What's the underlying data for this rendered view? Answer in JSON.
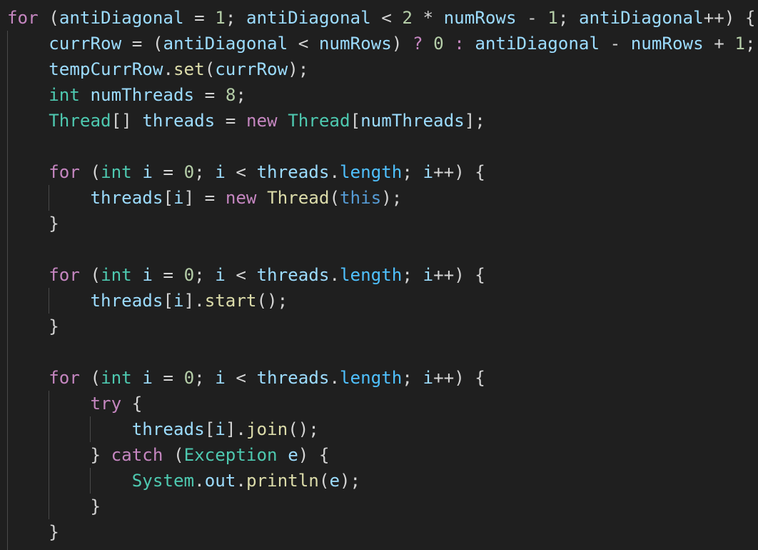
{
  "theme": {
    "background": "#1f1f1f",
    "colors": {
      "kw": "#c586c0",
      "var": "#9cdcfe",
      "num": "#b5cea8",
      "type": "#4ec9b0",
      "fn": "#dcdcaa",
      "prop": "#4fc1ff",
      "const": "#569cd6",
      "op": "#d4d4d4",
      "punc": "#d4d4d4",
      "ternary": "#c586c0",
      "guide": "#4a4a4a"
    }
  },
  "code": {
    "language": "java",
    "lines": [
      [
        [
          "kw",
          "for"
        ],
        [
          "punc",
          " ("
        ],
        [
          "var",
          "antiDiagonal"
        ],
        [
          "op",
          " = "
        ],
        [
          "num",
          "1"
        ],
        [
          "punc",
          "; "
        ],
        [
          "var",
          "antiDiagonal"
        ],
        [
          "op",
          " < "
        ],
        [
          "num",
          "2"
        ],
        [
          "op",
          " * "
        ],
        [
          "var",
          "numRows"
        ],
        [
          "op",
          " - "
        ],
        [
          "num",
          "1"
        ],
        [
          "punc",
          "; "
        ],
        [
          "var",
          "antiDiagonal"
        ],
        [
          "op",
          "++"
        ],
        [
          "punc",
          ") {"
        ]
      ],
      [
        [
          "punc",
          "    "
        ],
        [
          "var",
          "currRow"
        ],
        [
          "op",
          " = "
        ],
        [
          "punc",
          "("
        ],
        [
          "var",
          "antiDiagonal"
        ],
        [
          "op",
          " < "
        ],
        [
          "var",
          "numRows"
        ],
        [
          "punc",
          ") "
        ],
        [
          "ternary",
          "?"
        ],
        [
          "punc",
          " "
        ],
        [
          "num",
          "0"
        ],
        [
          "punc",
          " "
        ],
        [
          "ternary",
          ":"
        ],
        [
          "punc",
          " "
        ],
        [
          "var",
          "antiDiagonal"
        ],
        [
          "op",
          " - "
        ],
        [
          "var",
          "numRows"
        ],
        [
          "op",
          " + "
        ],
        [
          "num",
          "1"
        ],
        [
          "punc",
          ";"
        ]
      ],
      [
        [
          "punc",
          "    "
        ],
        [
          "var",
          "tempCurrRow"
        ],
        [
          "punc",
          "."
        ],
        [
          "fn",
          "set"
        ],
        [
          "punc",
          "("
        ],
        [
          "var",
          "currRow"
        ],
        [
          "punc",
          ");"
        ]
      ],
      [
        [
          "punc",
          "    "
        ],
        [
          "type",
          "int"
        ],
        [
          "punc",
          " "
        ],
        [
          "var",
          "numThreads"
        ],
        [
          "op",
          " = "
        ],
        [
          "num",
          "8"
        ],
        [
          "punc",
          ";"
        ]
      ],
      [
        [
          "punc",
          "    "
        ],
        [
          "type",
          "Thread"
        ],
        [
          "punc",
          "[] "
        ],
        [
          "var",
          "threads"
        ],
        [
          "op",
          " = "
        ],
        [
          "kw",
          "new"
        ],
        [
          "punc",
          " "
        ],
        [
          "type",
          "Thread"
        ],
        [
          "punc",
          "["
        ],
        [
          "var",
          "numThreads"
        ],
        [
          "punc",
          "];"
        ]
      ],
      [],
      [
        [
          "punc",
          "    "
        ],
        [
          "kw",
          "for"
        ],
        [
          "punc",
          " ("
        ],
        [
          "type",
          "int"
        ],
        [
          "punc",
          " "
        ],
        [
          "var",
          "i"
        ],
        [
          "op",
          " = "
        ],
        [
          "num",
          "0"
        ],
        [
          "punc",
          "; "
        ],
        [
          "var",
          "i"
        ],
        [
          "op",
          " < "
        ],
        [
          "var",
          "threads"
        ],
        [
          "punc",
          "."
        ],
        [
          "prop",
          "length"
        ],
        [
          "punc",
          "; "
        ],
        [
          "var",
          "i"
        ],
        [
          "op",
          "++"
        ],
        [
          "punc",
          ") {"
        ]
      ],
      [
        [
          "punc",
          "        "
        ],
        [
          "var",
          "threads"
        ],
        [
          "punc",
          "["
        ],
        [
          "var",
          "i"
        ],
        [
          "punc",
          "]"
        ],
        [
          "op",
          " = "
        ],
        [
          "kw",
          "new"
        ],
        [
          "punc",
          " "
        ],
        [
          "fn",
          "Thread"
        ],
        [
          "punc",
          "("
        ],
        [
          "const",
          "this"
        ],
        [
          "punc",
          ");"
        ]
      ],
      [
        [
          "punc",
          "    }"
        ]
      ],
      [],
      [
        [
          "punc",
          "    "
        ],
        [
          "kw",
          "for"
        ],
        [
          "punc",
          " ("
        ],
        [
          "type",
          "int"
        ],
        [
          "punc",
          " "
        ],
        [
          "var",
          "i"
        ],
        [
          "op",
          " = "
        ],
        [
          "num",
          "0"
        ],
        [
          "punc",
          "; "
        ],
        [
          "var",
          "i"
        ],
        [
          "op",
          " < "
        ],
        [
          "var",
          "threads"
        ],
        [
          "punc",
          "."
        ],
        [
          "prop",
          "length"
        ],
        [
          "punc",
          "; "
        ],
        [
          "var",
          "i"
        ],
        [
          "op",
          "++"
        ],
        [
          "punc",
          ") {"
        ]
      ],
      [
        [
          "punc",
          "        "
        ],
        [
          "var",
          "threads"
        ],
        [
          "punc",
          "["
        ],
        [
          "var",
          "i"
        ],
        [
          "punc",
          "]."
        ],
        [
          "fn",
          "start"
        ],
        [
          "punc",
          "();"
        ]
      ],
      [
        [
          "punc",
          "    }"
        ]
      ],
      [],
      [
        [
          "punc",
          "    "
        ],
        [
          "kw",
          "for"
        ],
        [
          "punc",
          " ("
        ],
        [
          "type",
          "int"
        ],
        [
          "punc",
          " "
        ],
        [
          "var",
          "i"
        ],
        [
          "op",
          " = "
        ],
        [
          "num",
          "0"
        ],
        [
          "punc",
          "; "
        ],
        [
          "var",
          "i"
        ],
        [
          "op",
          " < "
        ],
        [
          "var",
          "threads"
        ],
        [
          "punc",
          "."
        ],
        [
          "prop",
          "length"
        ],
        [
          "punc",
          "; "
        ],
        [
          "var",
          "i"
        ],
        [
          "op",
          "++"
        ],
        [
          "punc",
          ") {"
        ]
      ],
      [
        [
          "punc",
          "        "
        ],
        [
          "kw",
          "try"
        ],
        [
          "punc",
          " {"
        ]
      ],
      [
        [
          "punc",
          "            "
        ],
        [
          "var",
          "threads"
        ],
        [
          "punc",
          "["
        ],
        [
          "var",
          "i"
        ],
        [
          "punc",
          "]."
        ],
        [
          "fn",
          "join"
        ],
        [
          "punc",
          "();"
        ]
      ],
      [
        [
          "punc",
          "        } "
        ],
        [
          "kw",
          "catch"
        ],
        [
          "punc",
          " ("
        ],
        [
          "type",
          "Exception"
        ],
        [
          "punc",
          " "
        ],
        [
          "var",
          "e"
        ],
        [
          "punc",
          ") {"
        ]
      ],
      [
        [
          "punc",
          "            "
        ],
        [
          "type",
          "System"
        ],
        [
          "punc",
          "."
        ],
        [
          "var",
          "out"
        ],
        [
          "punc",
          "."
        ],
        [
          "fn",
          "println"
        ],
        [
          "punc",
          "("
        ],
        [
          "var",
          "e"
        ],
        [
          "punc",
          ");"
        ]
      ],
      [
        [
          "punc",
          "        }"
        ]
      ],
      [
        [
          "punc",
          "    }"
        ]
      ]
    ]
  }
}
